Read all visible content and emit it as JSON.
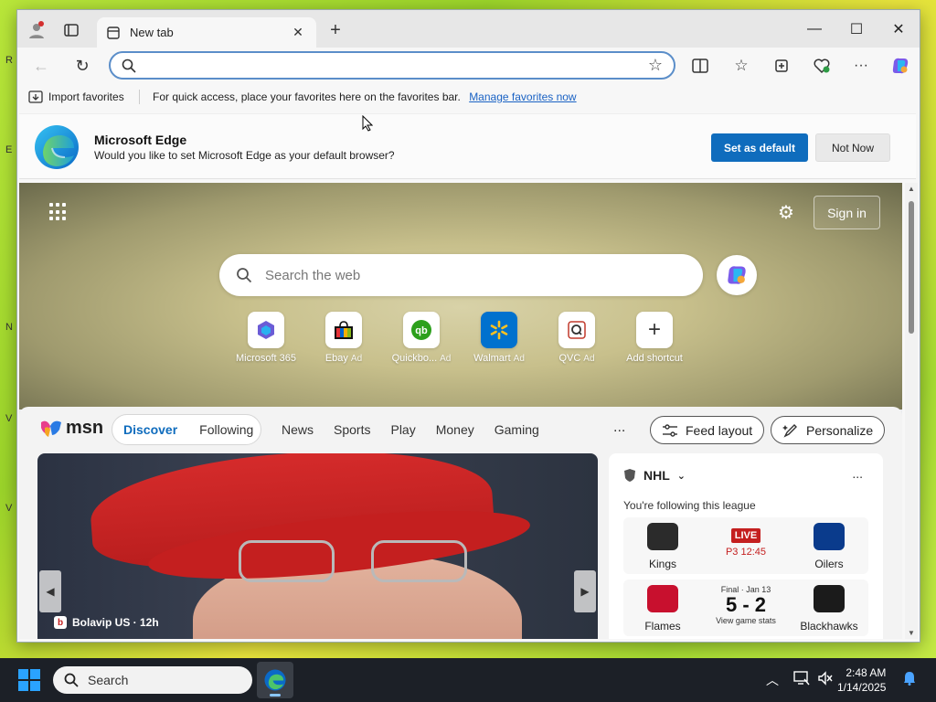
{
  "browser": {
    "tab_title": "New tab",
    "address_placeholder": "",
    "favbar": {
      "import_label": "Import favorites",
      "hint": "For quick access, place your favorites here on the favorites bar.",
      "manage_link": "Manage favorites now"
    },
    "banner": {
      "title": "Microsoft Edge",
      "message": "Would you like to set Microsoft Edge as your default browser?",
      "primary_button": "Set as default",
      "secondary_button": "Not Now"
    }
  },
  "newtab": {
    "signin": "Sign in",
    "search_placeholder": "Search the web",
    "shortcuts": [
      {
        "label": "Microsoft 365",
        "ad": "",
        "icon": "microsoft365-icon"
      },
      {
        "label": "Ebay",
        "ad": "Ad",
        "icon": "ebay-icon"
      },
      {
        "label": "Quickbo...",
        "ad": "Ad",
        "icon": "quickbooks-icon"
      },
      {
        "label": "Walmart",
        "ad": "Ad",
        "icon": "walmart-icon"
      },
      {
        "label": "QVC",
        "ad": "Ad",
        "icon": "qvc-icon"
      },
      {
        "label": "Add shortcut",
        "ad": "",
        "icon": "plus-icon"
      }
    ]
  },
  "feed": {
    "brand": "msn",
    "tabs": [
      "Discover",
      "Following"
    ],
    "active_tab": "Discover",
    "nav": [
      "News",
      "Sports",
      "Play",
      "Money",
      "Gaming"
    ],
    "more": "...",
    "feed_layout": "Feed layout",
    "personalize": "Personalize",
    "story_source": "Bolavip US · 12h",
    "nhl": {
      "league": "NHL",
      "subtitle": "You're following this league",
      "more": "...",
      "games": [
        {
          "home": "Kings",
          "away": "Oilers",
          "status": "LIVE",
          "clock": "P3 12:45",
          "home_color": "#2b2b2b",
          "away_color": "#0a3b8c"
        },
        {
          "home": "Flames",
          "away": "Blackhawks",
          "status": "Final · Jan 13",
          "score": "5 - 2",
          "link": "View game stats",
          "home_color": "#c8102e",
          "away_color": "#1b1b1b"
        }
      ]
    }
  },
  "taskbar": {
    "search_placeholder": "Search",
    "time": "2:48 AM",
    "date": "1/14/2025"
  },
  "colors": {
    "accent": "#0f6cbd",
    "live": "#c41f1f"
  }
}
